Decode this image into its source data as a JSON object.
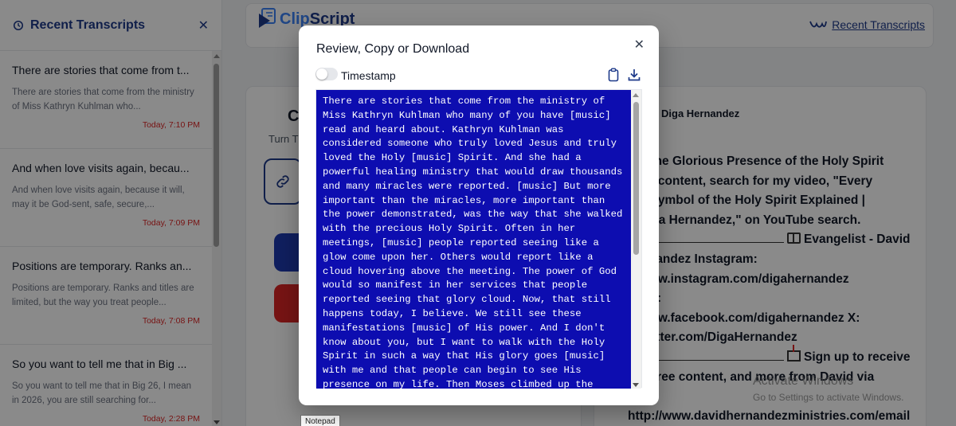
{
  "sidebar": {
    "title": "Recent Transcripts",
    "close_glyph": "✕",
    "items": [
      {
        "title": "There are stories that come from t...",
        "preview": "There are stories that come from the ministry of Miss Kathryn Kuhlman who...",
        "date": "Today, 7:10 PM"
      },
      {
        "title": "And when love visits again, becau...",
        "preview": "And when love visits again, because it will, may it be God-sent, safe, secure,...",
        "date": "Today, 7:09 PM"
      },
      {
        "title": "Positions are temporary. Ranks an...",
        "preview": "Positions are temporary. Ranks and titles are limited, but the way you treat people...",
        "date": "Today, 7:08 PM"
      },
      {
        "title": "So you want to tell me that in Big ...",
        "preview": "So you want to tell me that in Big 26, I mean in 2026, you are still searching for...",
        "date": "Today, 2:28 PM"
      }
    ]
  },
  "topbar": {
    "logo_a": "Clip",
    "logo_b": "Script",
    "recent_link": "Recent Transcripts"
  },
  "left_card": {
    "heading": "C",
    "subtitle": "Turn T"
  },
  "right_card": {
    "author": "Diga Hernandez",
    "lines": [
      "rts The Glorious Presence of the Holy Spirit",
      "nore content, search for my video, \"Every",
      "ent Symbol of the Holy Spirit Explained |",
      "d Diga Hernandez,\" on YouTube search.",
      "Hernandez Instagram:",
      "://www.instagram.com/digahernandez",
      "book:",
      "://www.facebook.com/digahernandez X:",
      "://twitter.com/DigaHernandez",
      "tes, free content, and more from David via",
      ":",
      "http://www.davidhernandezministries.com/email"
    ],
    "evangelist_text": "Evangelist - David",
    "signup_text": "Sign up to receive"
  },
  "watermark": {
    "title": "Activate Windows",
    "subtitle": "Go to Settings to activate Windows."
  },
  "tooltip": "Notepad",
  "modal": {
    "title": "Review, Copy or Download",
    "close_glyph": "✕",
    "timestamp_label": "Timestamp",
    "timestamp_on": false,
    "transcript": "There are stories that come from the ministry of Miss Kathryn Kuhlman who many of you have [music] read and heard about. Kathryn Kuhlman was considered someone who truly loved Jesus and truly loved the Holy [music] Spirit. And she had a powerful healing ministry that would draw thousands and many miracles were reported. [music] But more important than the miracles, more important than the power demonstrated, was the way that she walked with the precious Holy Spirit. Often in her meetings, [music] people reported seeing like a glow come upon her. Others would report like a cloud hovering above the meeting. The power of God would so manifest in her services that people reported seeing that glory cloud. Now, that still happens today, I believe. We still see these manifestations [music] of His power. And I don't know about you, but I want to walk with the Holy Spirit in such a way that His glory goes [music] with me and that people can begin to see His presence on my life. Then Moses climbed up the mountain and the cloud covered it. And the glory of the Lord settled down on Mount Sinai, and the cloud covered"
  },
  "icons": {
    "history": "history-icon",
    "copy": "clipboard-icon",
    "download": "download-icon",
    "link": "link-icon",
    "wave": "wave-icon"
  },
  "colors": {
    "brand": "#1e3a8a",
    "selection": "#0d0db0",
    "date": "#dc2626",
    "danger_button": "#dc2626"
  }
}
